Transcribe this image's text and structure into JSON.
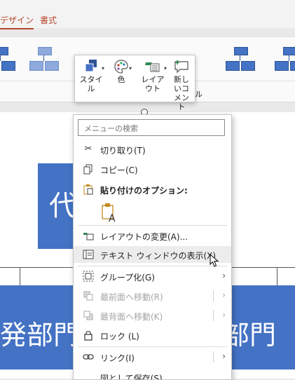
{
  "ribbon": {
    "tabs": [
      {
        "label": "デザイン"
      },
      {
        "label": "書式"
      }
    ]
  },
  "mini_toolbar": {
    "style": "スタイル",
    "color": "色",
    "layout": "レイアウト",
    "new_comment": "新しいコメント",
    "peek_text": "ル"
  },
  "slide": {
    "top_box_text": "代",
    "bottom_left_text": "発部門",
    "bottom_right_text": "部門"
  },
  "context_menu": {
    "search_placeholder": "メニューの検索",
    "items": [
      {
        "label": "切り取り(T)",
        "icon": "scissors-icon"
      },
      {
        "label": "コピー(C)",
        "icon": "copy-icon"
      },
      {
        "label": "貼り付けのオプション:",
        "icon": "paste-icon"
      },
      {
        "label": "レイアウトの変更(A)...",
        "icon": "layout-icon"
      },
      {
        "label": "テキスト ウィンドウの表示(X)",
        "icon": "text-pane-icon"
      },
      {
        "label": "グループ化(G)",
        "icon": "group-icon"
      },
      {
        "label": "最前面へ移動(R)",
        "icon": "bring-front-icon"
      },
      {
        "label": "最背面へ移動(K)",
        "icon": "send-back-icon"
      },
      {
        "label": "ロック (L)",
        "icon": "lock-icon"
      },
      {
        "label": "リンク(I)",
        "icon": "link-icon"
      },
      {
        "label": "図として保存(S)...",
        "icon": "save-as-picture-icon"
      }
    ]
  },
  "colors": {
    "accent": "#b7472a",
    "smartart_blue": "#4472c4",
    "menu_highlight": "#ececec"
  }
}
